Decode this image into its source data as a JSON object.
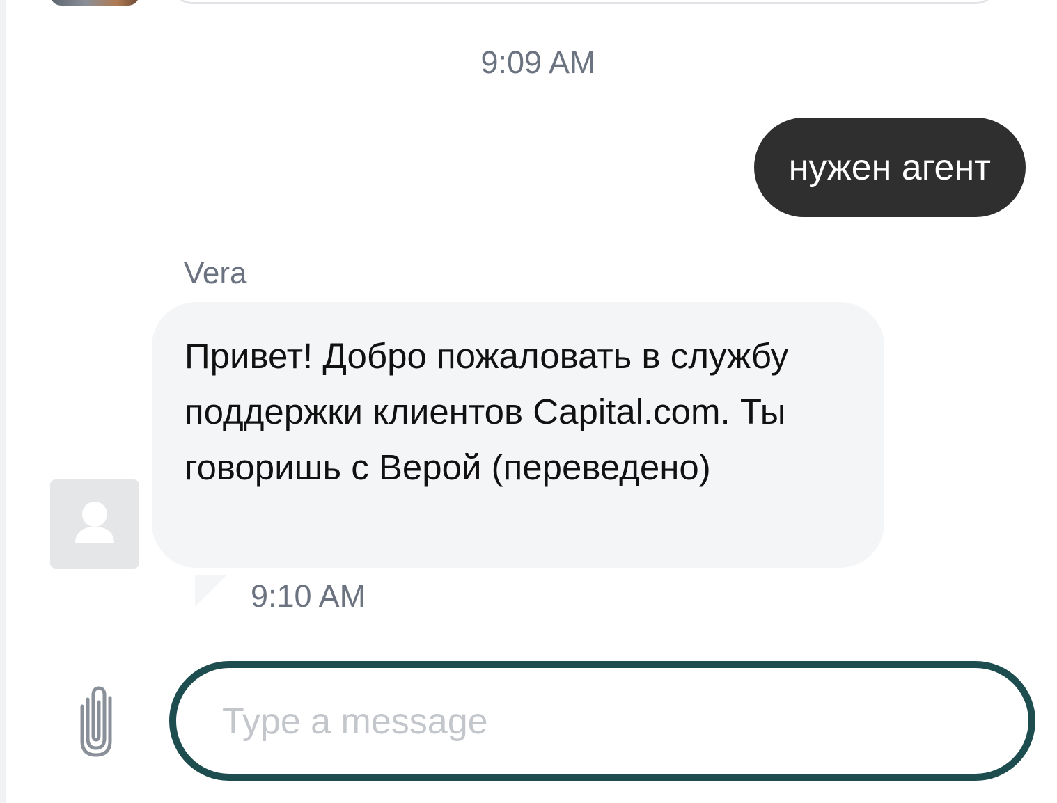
{
  "chat": {
    "timestamp_top": "9:09 AM",
    "user_message": {
      "text": "нужен агент"
    },
    "agent_message": {
      "sender": "Vera",
      "text": "Привет! Добро пожаловать в службу поддержки клиентов Capital.com. Ты говоришь с Верой (переведено)",
      "time": "9:10 AM",
      "avatar_icon": "user-silhouette-icon"
    }
  },
  "composer": {
    "placeholder": "Type a message",
    "value": "",
    "attach_icon": "paperclip-icon",
    "border_color": "#1e4d50"
  },
  "colors": {
    "user_bubble": "#2f2f2f",
    "agent_bubble": "#f4f5f7",
    "muted_text": "#6b7280"
  }
}
